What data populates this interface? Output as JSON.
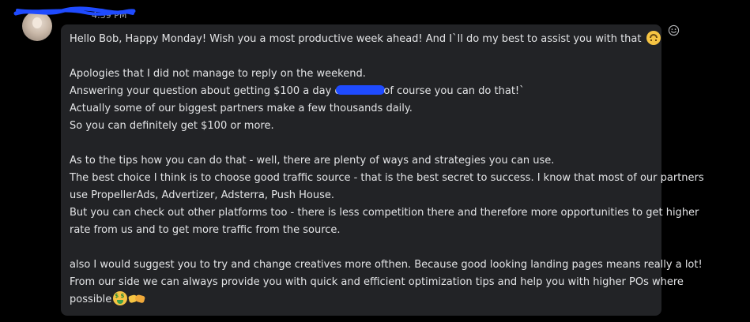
{
  "message": {
    "timestamp": "4:39 PM",
    "lines": {
      "l1": "Hello Bob, Happy Monday! Wish you a most productive week ahead! And I`ll do my best to assist you with that",
      "l2": "Apologies that I did not manage to reply on the weekend.",
      "l3a": "Answering your question about getting $100 a day o",
      "l3b": "of course you can do that!`",
      "l4": "Actually some of our biggest partners make a few thousands daily.",
      "l5": "So you can definitely get $100 or more.",
      "l6": "As to the tips how you can do that - well, there are plenty of ways and strategies you can use.",
      "l7": "The best choice I think is to choose good traffic source - that is the best secret to success. I know that most of our partners",
      "l8": "use PropellerAds, Advertizer, Adsterra, Push House.",
      "l9": "But you can check out other platforms too - there is less competition there and therefore more opportunities to get higher",
      "l10": "rate from us and to get more traffic from the source.",
      "l11": "also I would suggest you to try and change creatives more ofthen. Because good looking landing pages means really a lot!",
      "l12": "From  our side we can always provide you with quick and efficient optimization tips and help you with higher POs where",
      "l13": "possible"
    },
    "emojis": {
      "greeting": "upside-down-face",
      "closing_1": "money-mouth-face",
      "closing_2": "handshake"
    }
  },
  "icons": {
    "reaction": "smiley-reaction-icon"
  },
  "colors": {
    "background": "#000000",
    "bubble": "#222326",
    "text": "#e3e4e6",
    "redaction": "#1f4bff"
  }
}
